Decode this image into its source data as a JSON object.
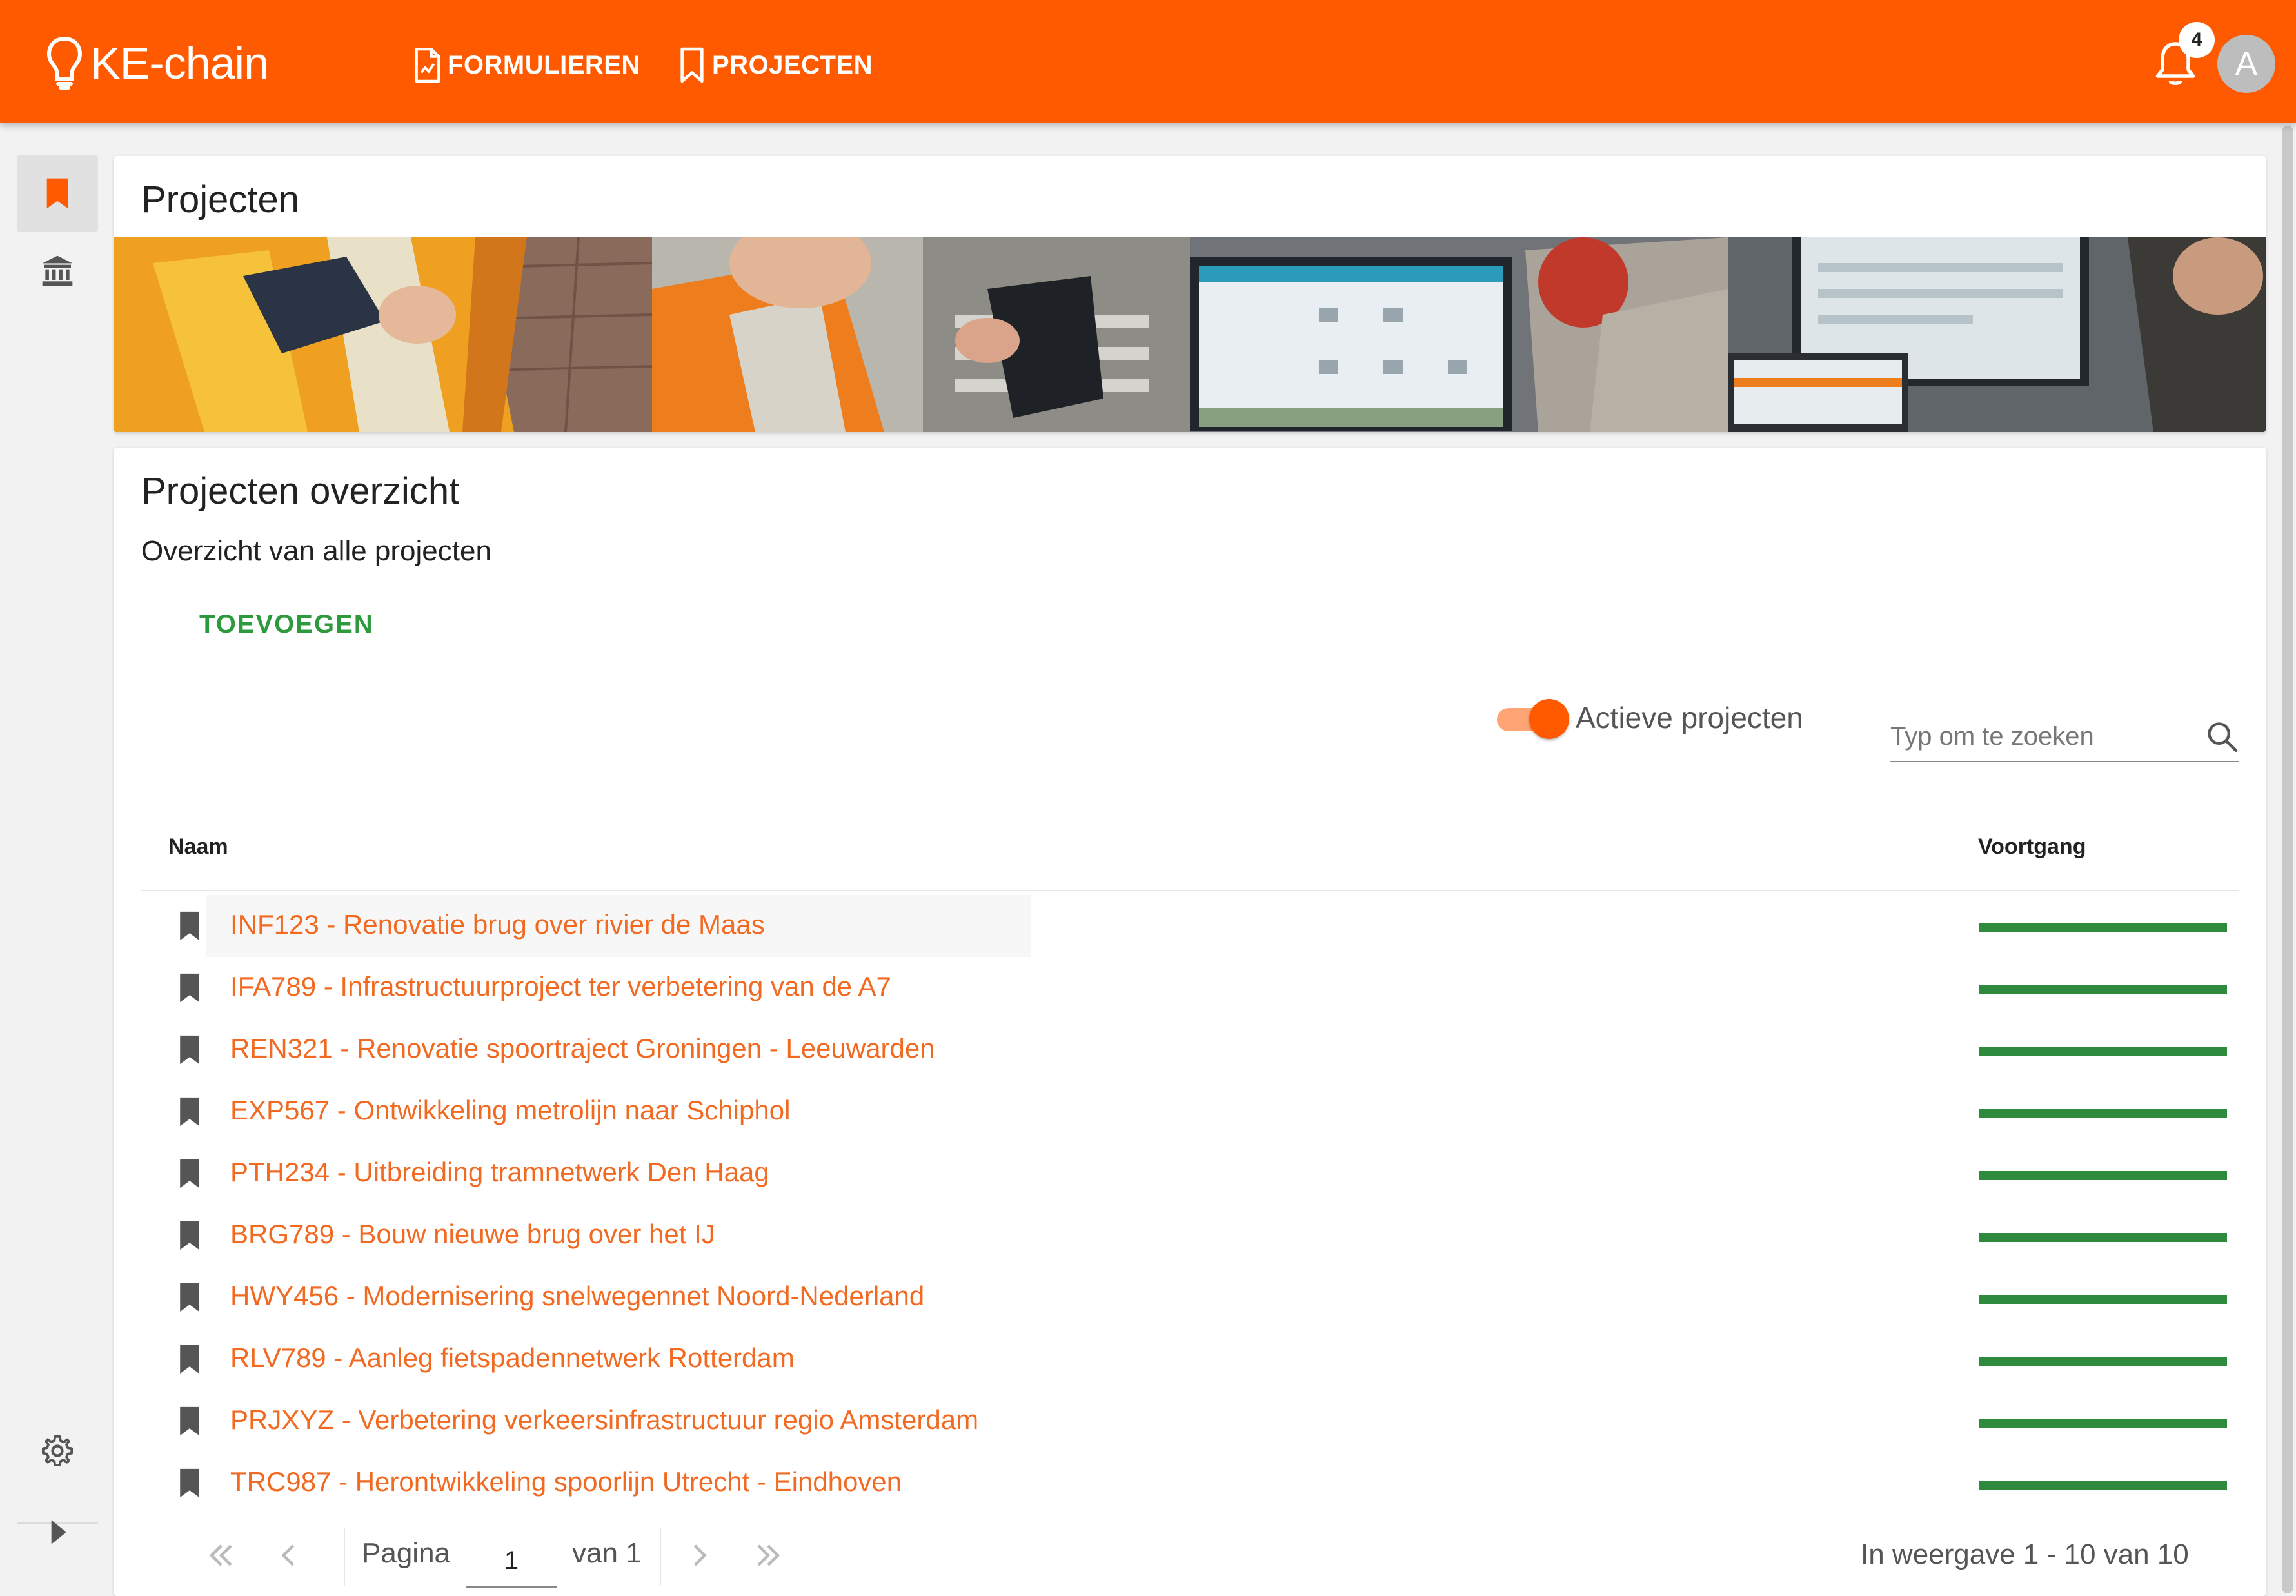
{
  "app": {
    "logo_text": "KE-chain",
    "nav": [
      {
        "label": "FORMULIEREN",
        "icon": "form-icon"
      },
      {
        "label": "PROJECTEN",
        "icon": "bookmark-icon"
      }
    ],
    "notifications_count": "4",
    "avatar_initial": "A"
  },
  "sidebar": {
    "items": [
      {
        "icon": "bookmark-icon",
        "active": true
      },
      {
        "icon": "bank-icon",
        "active": false
      }
    ],
    "bottom": [
      {
        "icon": "gear-icon"
      },
      {
        "icon": "expand-arrow-icon"
      }
    ]
  },
  "header": {
    "title": "Projecten"
  },
  "overview": {
    "title": "Projecten overzicht",
    "subtitle": "Overzicht van alle projecten",
    "add_label": "TOEVOEGEN",
    "toggle_label": "Actieve projecten",
    "toggle_on": true,
    "search_placeholder": "Typ om te zoeken"
  },
  "table": {
    "columns": [
      "Naam",
      "Voortgang"
    ],
    "rows": [
      {
        "name": "INF123 - Renovatie brug over rivier de Maas",
        "progress": 1.0
      },
      {
        "name": "IFA789 - Infrastructuurproject ter verbetering van de A7",
        "progress": 1.0
      },
      {
        "name": "REN321 - Renovatie spoortraject Groningen - Leeuwarden",
        "progress": 1.0
      },
      {
        "name": "EXP567 - Ontwikkeling metrolijn naar Schiphol",
        "progress": 1.0
      },
      {
        "name": "PTH234 - Uitbreiding tramnetwerk Den Haag",
        "progress": 1.0
      },
      {
        "name": "BRG789 - Bouw nieuwe brug over het IJ",
        "progress": 1.0
      },
      {
        "name": "HWY456 - Modernisering snelwegennet Noord-Nederland",
        "progress": 1.0
      },
      {
        "name": "RLV789 - Aanleg fietspadennetwerk Rotterdam",
        "progress": 1.0
      },
      {
        "name": "PRJXYZ - Verbetering verkeersinfrastructuur regio Amsterdam",
        "progress": 1.0
      },
      {
        "name": "TRC987 - Herontwikkeling spoorlijn Utrecht - Eindhoven",
        "progress": 1.0
      }
    ]
  },
  "pagination": {
    "page_label": "Pagina",
    "page_value": "1",
    "of_label": "van 1",
    "info": "In weergave 1 - 10 van 10"
  },
  "colors": {
    "brand": "#ff5a00",
    "link": "#f26a21",
    "progress": "#2e8b3d",
    "add_button": "#2e9a3e"
  }
}
